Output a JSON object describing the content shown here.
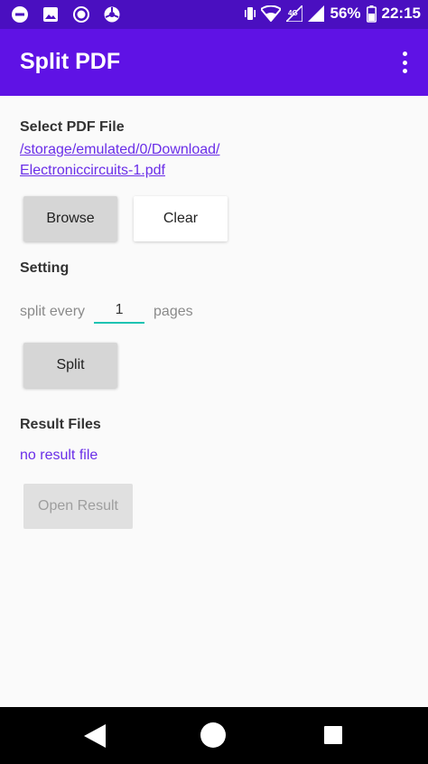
{
  "status_bar": {
    "icons_left": [
      "minus-circle-icon",
      "image-icon",
      "record-icon",
      "steering-icon"
    ],
    "icons_right": [
      "vibrate-icon",
      "wifi-icon",
      "mobile-signal-icon",
      "signal-icon",
      "battery-icon"
    ],
    "battery": "56%",
    "time": "22:15"
  },
  "app_bar": {
    "title": "Split PDF",
    "menu_icon": "more-vert-icon",
    "color": "#5f12e5"
  },
  "select_section": {
    "label": "Select PDF File",
    "path_line1": "/storage/emulated/0/Download/",
    "path_line2": "Electroniccircuits-1.pdf",
    "browse_label": "Browse",
    "clear_label": "Clear"
  },
  "setting_section": {
    "label": "Setting",
    "prefix": "split every",
    "value": "1",
    "suffix": "pages",
    "split_label": "Split"
  },
  "result_section": {
    "label": "Result Files",
    "result_text": "no result file",
    "open_label": "Open Result"
  },
  "nav_bar": {
    "back_icon": "back-triangle-icon",
    "home_icon": "home-circle-icon",
    "recents_icon": "recents-square-icon"
  }
}
